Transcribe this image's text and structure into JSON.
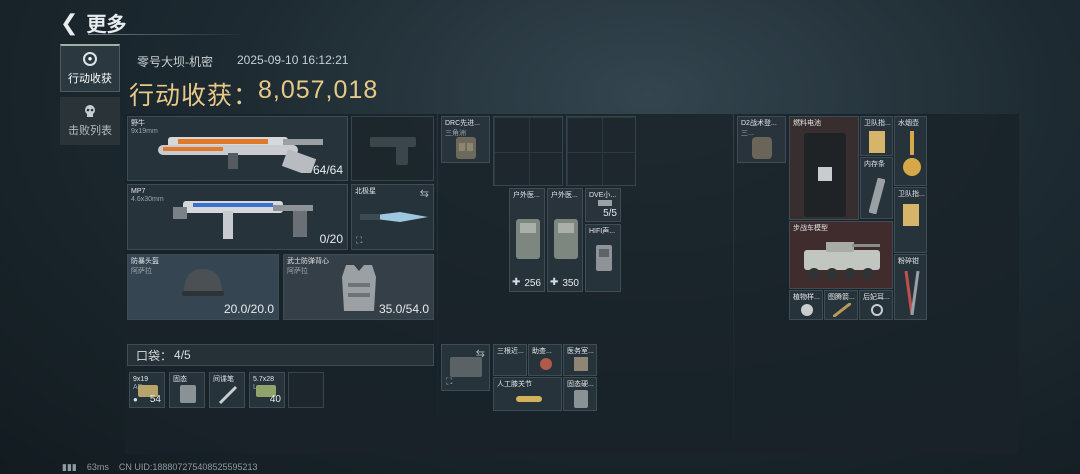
{
  "header": {
    "back_label": "更多"
  },
  "nav": [
    {
      "label": "行动收获",
      "icon": "target-icon",
      "active": true
    },
    {
      "label": "击败列表",
      "icon": "skull-icon",
      "active": false
    }
  ],
  "session": {
    "map": "零号大坝-机密",
    "datetime": "2025-09-10 16:12:21",
    "haul_label": "行动收获：",
    "haul_value": "8,057,018"
  },
  "loadout": {
    "primary": {
      "name": "野牛",
      "caliber": "9x19mm",
      "ammo": "64/64"
    },
    "secondary": {
      "name": "MP7",
      "caliber": "4.6x30mm",
      "ammo": "0/20"
    },
    "melee": {
      "name": "北极星"
    },
    "helmet": {
      "name": "防暴头盔",
      "maker": "阿萨拉",
      "durability": "20.0/20.0"
    },
    "armor": {
      "name": "武士防弹背心",
      "maker": "阿萨拉",
      "durability": "35.0/54.0"
    }
  },
  "pockets": {
    "label": "口袋：",
    "count": "4/5",
    "items": [
      {
        "name": "9x19",
        "sub": "AP",
        "qty": "54"
      },
      {
        "name": "固态",
        "qty": ""
      },
      {
        "name": "间谍笔",
        "qty": ""
      },
      {
        "name": "5.7x28",
        "sub": "L",
        "qty": "40"
      }
    ]
  },
  "chest_rig": {
    "name": "DRC先进...",
    "sub": "三角洲"
  },
  "rig_items": [
    {
      "name": "户外医...",
      "qty": "256"
    },
    {
      "name": "户外医...",
      "qty": "350"
    },
    {
      "name": "DVE小...",
      "qty": "5/5"
    },
    {
      "name": "HIFI声..."
    }
  ],
  "secure_case_items": [
    {
      "name": "三根近..."
    },
    {
      "name": "助查..."
    },
    {
      "name": "医务室..."
    },
    {
      "name": "人工膝关节"
    },
    {
      "name": "固态硬..."
    }
  ],
  "backpack": {
    "name": "D2战术登...",
    "sub": "三..."
  },
  "backpack_items": [
    {
      "name": "燃料电池"
    },
    {
      "name": "卫队指..."
    },
    {
      "name": "水烟壶"
    },
    {
      "name": "内存条"
    },
    {
      "name": "卫队指..."
    },
    {
      "name": "步战车模型"
    },
    {
      "name": "粉碎钳"
    },
    {
      "name": "植物样..."
    },
    {
      "name": "图腾箭..."
    },
    {
      "name": "后妃耳..."
    }
  ],
  "status_bar": {
    "ping": "63ms",
    "uid": "CN UID:18880727540852559521​3"
  },
  "colors": {
    "accent": "#e8c988",
    "panel": "#182228",
    "slot": "#2a363e"
  }
}
